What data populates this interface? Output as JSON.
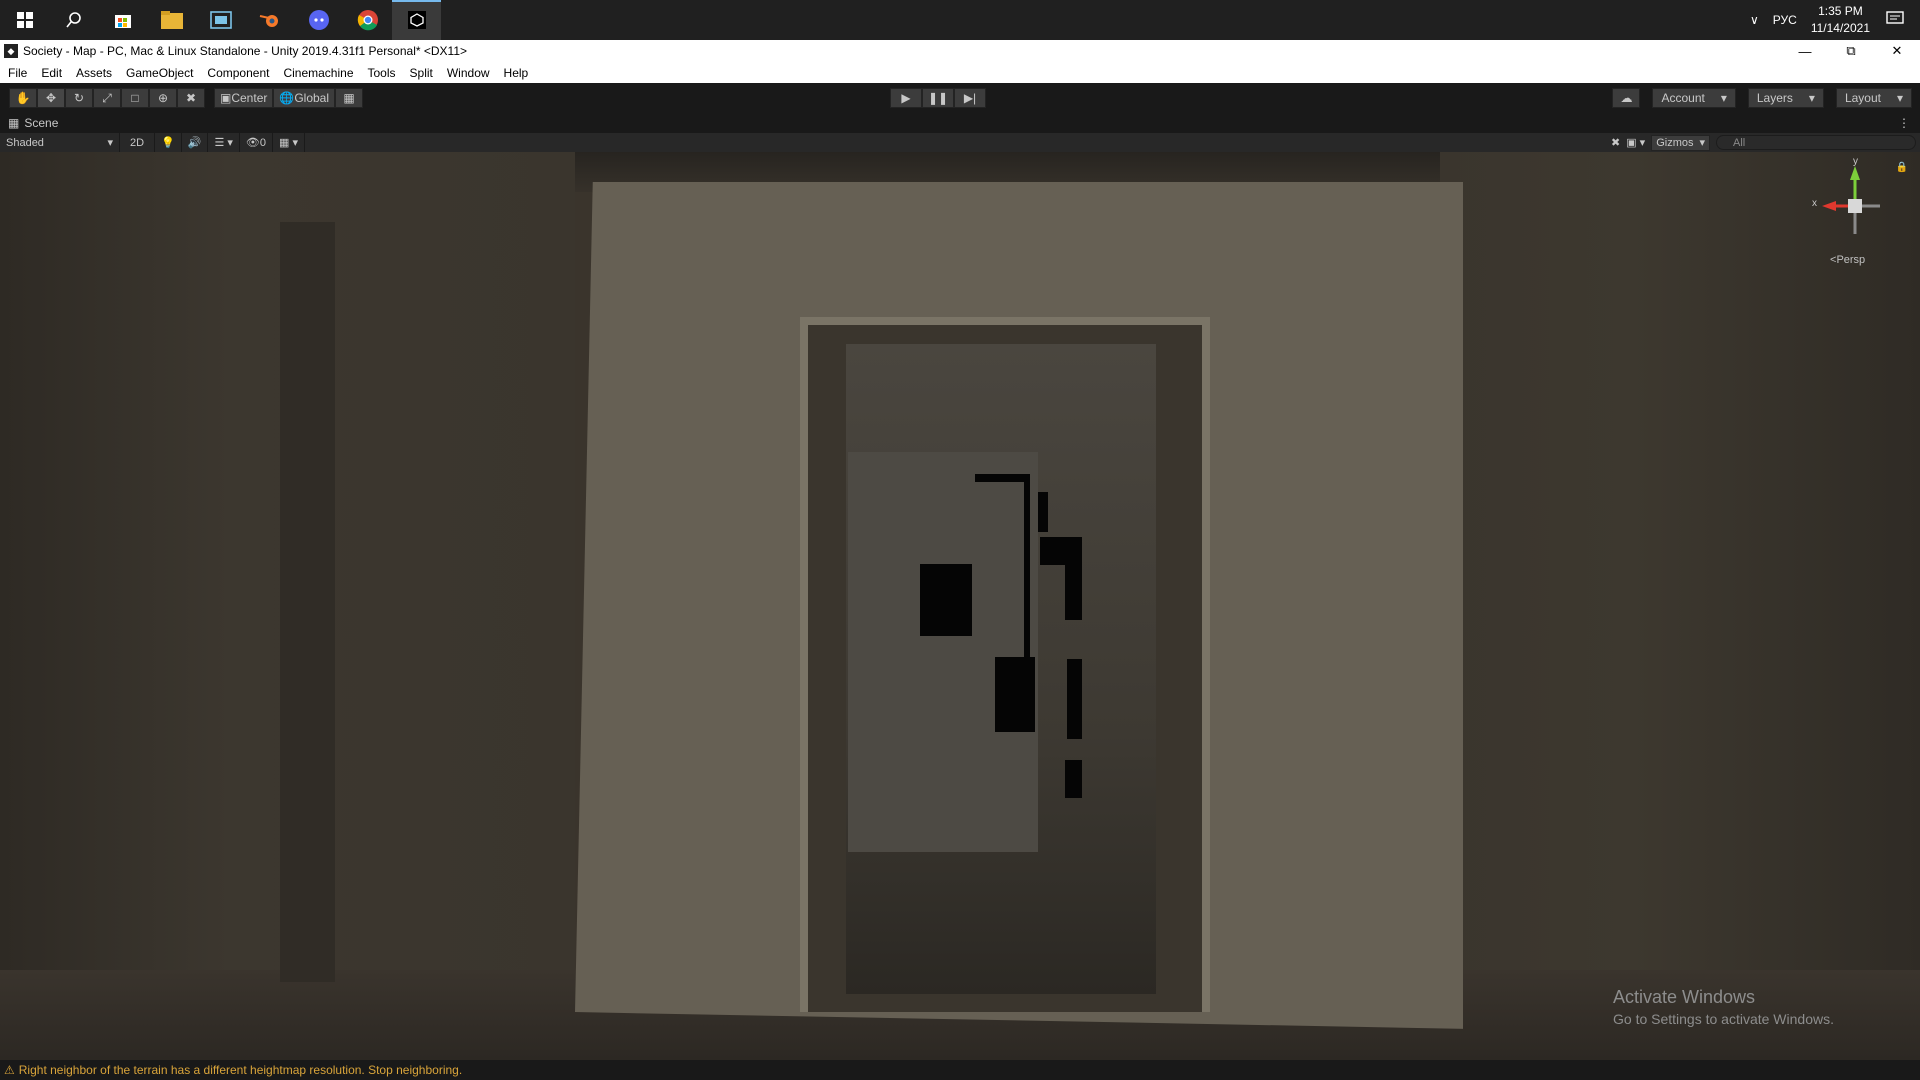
{
  "taskbar": {
    "icons": [
      "windows-start-icon",
      "search-icon",
      "store-icon",
      "file-explorer-icon",
      "media-app-icon",
      "blender-icon",
      "discord-icon",
      "chrome-icon",
      "unity-icon"
    ],
    "lang": "РУС",
    "time": "1:35 PM",
    "date": "11/14/2021"
  },
  "window": {
    "title": "Society - Map - PC, Mac & Linux Standalone - Unity 2019.4.31f1 Personal* <DX11>"
  },
  "menu": {
    "items": [
      "File",
      "Edit",
      "Assets",
      "GameObject",
      "Component",
      "Cinemachine",
      "Tools",
      "Split",
      "Window",
      "Help"
    ]
  },
  "toolbar": {
    "pivot": "Center",
    "space": "Global",
    "account": "Account",
    "layers": "Layers",
    "layout": "Layout"
  },
  "scene": {
    "tab": "Scene",
    "shading": "Shaded",
    "mode2d": "2D",
    "hidden_count": "0",
    "gizmos": "Gizmos",
    "search_placeholder": "All",
    "persp": "Persp",
    "axis_y": "y",
    "axis_x": "x"
  },
  "watermark": {
    "title": "Activate Windows",
    "subtitle": "Go to Settings to activate Windows."
  },
  "status": {
    "message": "Right neighbor of the terrain has a different heightmap resolution. Stop neighboring."
  },
  "colors": {
    "status_warning": "#d9a43a",
    "accent": "#76b9ed"
  }
}
